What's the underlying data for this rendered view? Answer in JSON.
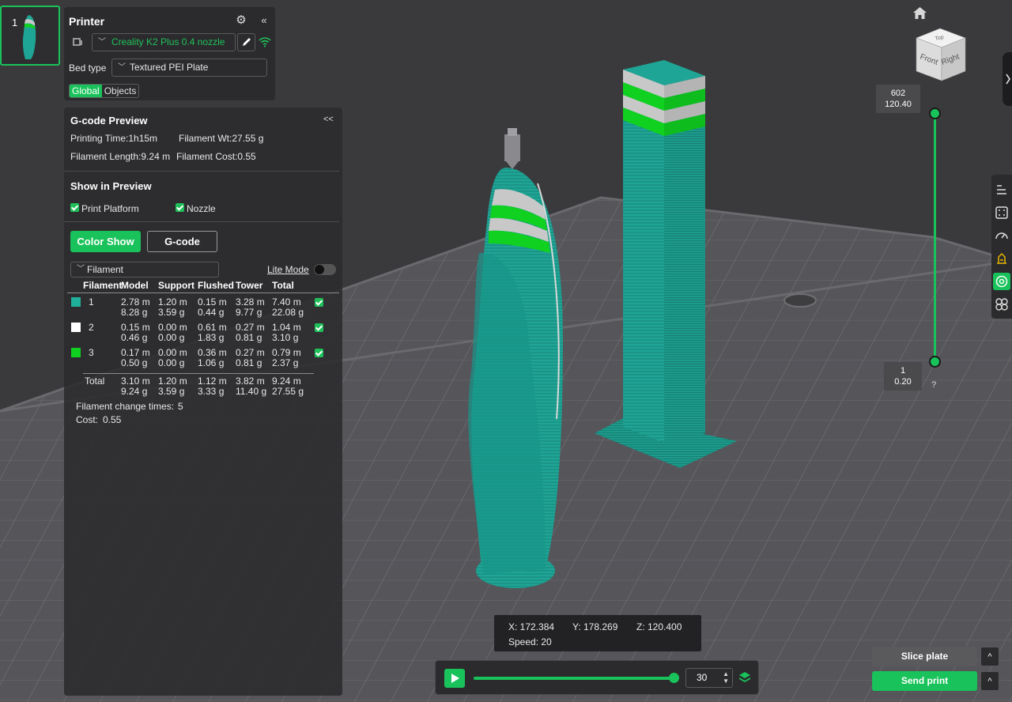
{
  "plate": {
    "number": "1"
  },
  "printer": {
    "title": "Printer",
    "selected_printer": "Creality K2 Plus 0.4 nozzle",
    "bed_type_label": "Bed type",
    "bed_type_value": "Textured PEI Plate",
    "tabs": [
      "Global",
      "Objects"
    ]
  },
  "gcode_preview": {
    "title": "G-code Preview",
    "collapse": "<<",
    "printing_time": "Printing Time:1h15m",
    "filament_wt": "Filament Wt:27.55 g",
    "filament_length": "Filament Length:9.24 m",
    "filament_cost": "Filament Cost:0.55",
    "show_title": "Show in Preview",
    "print_platform": "Print Platform",
    "nozzle": "Nozzle",
    "color_show": "Color Show",
    "gcode": "G-code",
    "view_select": "Filament",
    "lite_mode": "Lite Mode",
    "columns": [
      "Filament",
      "Model",
      "Support",
      "Flushed",
      "Tower",
      "Total"
    ],
    "rows": [
      {
        "id": "1",
        "color": "#1fb09a",
        "model": [
          "2.78 m",
          "8.28 g"
        ],
        "support": [
          "1.20 m",
          "3.59 g"
        ],
        "flushed": [
          "0.15 m",
          "0.44 g"
        ],
        "tower": [
          "3.28 m",
          "9.77 g"
        ],
        "total": [
          "7.40 m",
          "22.08 g"
        ]
      },
      {
        "id": "2",
        "color": "#ffffff",
        "model": [
          "0.15 m",
          "0.46 g"
        ],
        "support": [
          "0.00 m",
          "0.00 g"
        ],
        "flushed": [
          "0.61 m",
          "1.83 g"
        ],
        "tower": [
          "0.27 m",
          "0.81 g"
        ],
        "total": [
          "1.04 m",
          "3.10 g"
        ]
      },
      {
        "id": "3",
        "color": "#10d020",
        "model": [
          "0.17 m",
          "0.50 g"
        ],
        "support": [
          "0.00 m",
          "0.00 g"
        ],
        "flushed": [
          "0.36 m",
          "1.06 g"
        ],
        "tower": [
          "0.27 m",
          "0.81 g"
        ],
        "total": [
          "0.79 m",
          "2.37 g"
        ]
      }
    ],
    "total_row": {
      "label": "Total",
      "model": [
        "3.10 m",
        "9.24 g"
      ],
      "support": [
        "1.20 m",
        "3.59 g"
      ],
      "flushed": [
        "1.12 m",
        "3.33 g"
      ],
      "tower": [
        "3.82 m",
        "11.40 g"
      ],
      "total": [
        "9.24 m",
        "27.55 g"
      ]
    },
    "change_times_label": "Filament change times:",
    "change_times_value": "5",
    "cost_label": "Cost:",
    "cost_value": "0.55"
  },
  "view_cube": {
    "top": "Top",
    "front": "Front",
    "right": "Right"
  },
  "layer_slider": {
    "top_layer": "602",
    "top_height": "120.40",
    "bottom_layer": "1",
    "bottom_height": "0.20",
    "help": "?"
  },
  "position_readout": {
    "x": "X: 172.384",
    "y": "Y: 178.269",
    "z": "Z: 120.400",
    "speed": "Speed: 20"
  },
  "playback": {
    "value": "30",
    "progress": 1.0
  },
  "actions": {
    "slice_plate": "Slice plate",
    "send_print": "Send print",
    "more": "^"
  },
  "colors": {
    "accent": "#19c25a",
    "model_teal": "#1fa595",
    "stripe_green": "#10d020",
    "stripe_white": "#c8c8c8"
  }
}
